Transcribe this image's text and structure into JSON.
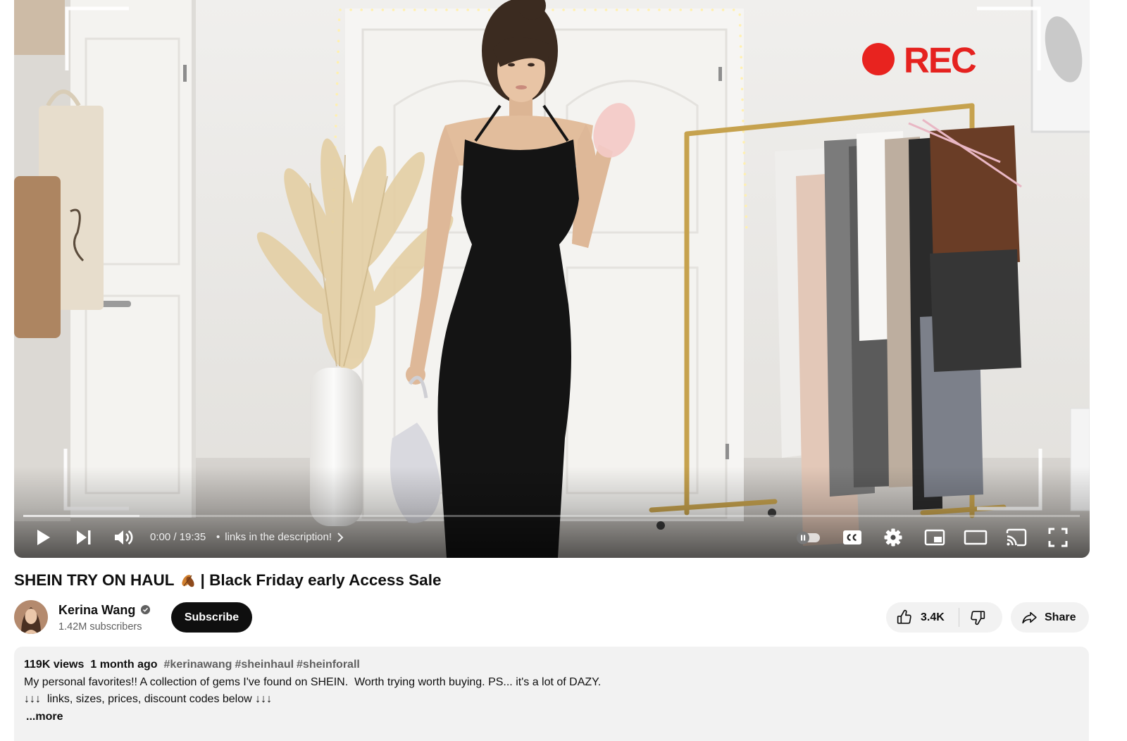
{
  "video": {
    "overlay_text": "REC",
    "progress": {
      "played_fraction": 0,
      "buffered_fraction": 0.11
    },
    "time_display": "0:00 / 19:35",
    "chapter_separator": "•",
    "chapter_title": "links in the description!",
    "controls": {
      "left": [
        "play-icon",
        "next-icon",
        "volume-icon"
      ],
      "right": [
        "autoplay-toggle-icon",
        "captions-icon",
        "settings-gear-icon",
        "miniplayer-icon",
        "theater-mode-icon",
        "cast-icon",
        "fullscreen-icon"
      ]
    }
  },
  "title": {
    "before_emoji": "SHEIN TRY ON HAUL",
    "emoji_icon": "fallen-leaf-emoji",
    "after_emoji": "| Black Friday early Access Sale"
  },
  "channel": {
    "name": "Kerina Wang",
    "verified_icon": "verified-check-icon",
    "subscribers": "1.42M subscribers",
    "subscribe_label": "Subscribe"
  },
  "actions": {
    "like_count": "3.4K",
    "share_label": "Share"
  },
  "description": {
    "views": "119K views",
    "time_ago": "1 month ago",
    "hashtags": [
      "#kerinawang",
      "#sheinhaul",
      "#sheinforall"
    ],
    "lines": [
      "My personal favorites!! A collection of gems I've found on SHEIN.  Worth trying worth buying. PS... it's a lot of DAZY.",
      "↓↓↓  links, sizes, prices, discount codes below ↓↓↓"
    ],
    "more_label": "...more"
  },
  "colors": {
    "rec_red": "#e5221f",
    "subscribe_bg": "#0f0f0f",
    "pill_bg": "#f2f2f2",
    "secondary_text": "#606060"
  }
}
